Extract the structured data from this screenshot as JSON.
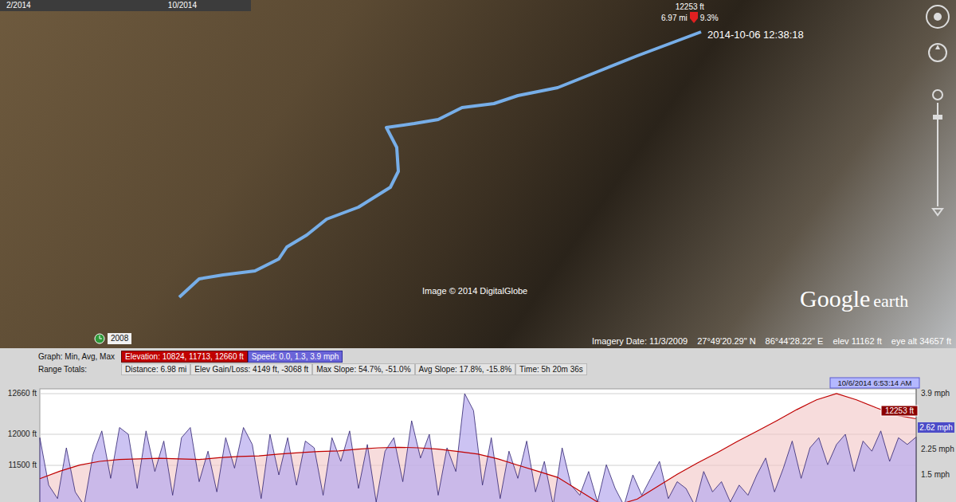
{
  "time_slider": {
    "start": "2/2014",
    "end": "10/2014"
  },
  "map": {
    "pin": {
      "elevation": "12253 ft",
      "distance": "6.97 mi",
      "slope": "9.3%",
      "timestamp": "2014-10-06 12:38:18"
    },
    "attribution": "Image © 2014 DigitalGlobe",
    "logo": {
      "brand": "Google",
      "product": "earth"
    },
    "historical_year": "2008"
  },
  "status_bar": {
    "imagery_date": "Imagery Date: 11/3/2009",
    "latitude": "27°49'20.29\" N",
    "longitude": "86°44'28.22\" E",
    "elevation": "elev 11162 ft",
    "eye_altitude": "eye alt 34657 ft"
  },
  "graph": {
    "label": "Graph: Min, Avg, Max",
    "series": [
      {
        "name": "Elevation: 10824, 11713, 12660 ft",
        "kind": "line",
        "color": "#c00000",
        "selected": true,
        "values": [
          11280,
          11400,
          11500,
          11560,
          11590,
          11600,
          11610,
          11600,
          11590,
          11620,
          11640,
          11650,
          11680,
          11700,
          11720,
          11730,
          11760,
          11780,
          11790,
          11780,
          11760,
          11720,
          11680,
          11600,
          11500,
          11400,
          11300,
          11100,
          10900,
          10850,
          10950,
          11150,
          11350,
          11530,
          11700,
          11880,
          12050,
          12220,
          12400,
          12560,
          12660,
          12560,
          12430,
          12310,
          12253
        ]
      },
      {
        "name": "Speed: 0.0, 1.3, 3.9 mph",
        "kind": "area",
        "color": "#6a64d8",
        "selected": false,
        "values": [
          2.6,
          1.2,
          0.8,
          2.3,
          1.0,
          0.6,
          2.1,
          2.8,
          1.4,
          2.9,
          2.7,
          1.1,
          2.8,
          1.6,
          2.5,
          0.9,
          2.6,
          2.9,
          1.3,
          2.2,
          1.0,
          2.6,
          1.7,
          2.9,
          2.4,
          0.8,
          2.7,
          1.5,
          2.6,
          1.2,
          2.5,
          2.3,
          0.9,
          2.6,
          1.9,
          2.8,
          1.1,
          2.4,
          0.7,
          2.2,
          2.6,
          1.3,
          3.1,
          2.0,
          2.7,
          0.9,
          2.3,
          1.6,
          3.9,
          3.4,
          1.2,
          2.6,
          0.8,
          2.2,
          1.4,
          2.5,
          1.0,
          1.9,
          0.6,
          2.3,
          1.2,
          0.9,
          1.6,
          0.7,
          1.8,
          1.1,
          0.6,
          1.5,
          0.9,
          1.4,
          1.9,
          0.8,
          1.3,
          1.1,
          0.6,
          1.6,
          1.0,
          1.3,
          0.7,
          1.2,
          0.9,
          1.5,
          2.0,
          1.0,
          1.7,
          2.5,
          1.4,
          2.3,
          2.6,
          1.8,
          2.4,
          2.7,
          1.6,
          2.5,
          2.2,
          2.8,
          1.9,
          2.6,
          2.4,
          2.62
        ]
      }
    ],
    "range_totals": {
      "label": "Range Totals:",
      "items": [
        "Distance: 6.98 mi",
        "Elev Gain/Loss: 4149 ft, -3068 ft",
        "Max Slope: 54.7%, -51.0%",
        "Avg Slope: 17.8%, -15.8%",
        "Time: 5h 20m 36s"
      ]
    },
    "left_ticks": [
      "12660 ft",
      "12000 ft",
      "11500 ft"
    ],
    "right_ticks": [
      "3.9 mph",
      "2.25 mph",
      "1.5 mph"
    ],
    "cursor": {
      "time": "10/6/2014 6:53:14 AM",
      "elevation": "12253 ft",
      "speed": "2.62 mph"
    }
  }
}
